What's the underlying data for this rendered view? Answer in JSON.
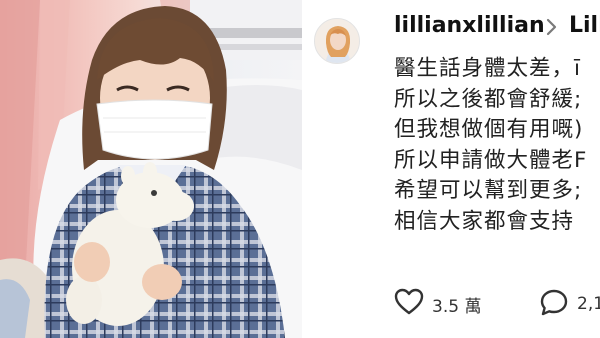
{
  "post": {
    "username": "lillianxlillian",
    "separator_icon": "chevron-right-icon",
    "reply_to_username": "Lill",
    "caption_lines": [
      "醫生話身體太差，ī",
      "所以之後都會舒緩;",
      "但我想做個有用嘅)",
      "所以申請做大體老F",
      "希望可以幫到更多;",
      "相信大家都會支持"
    ],
    "likes": "3.5 萬",
    "comments": "2,1"
  },
  "photo": {
    "subject": "woman-with-mask-holding-plush",
    "plush_icon": "moomin-plush"
  },
  "colors": {
    "text": "#222222",
    "muted": "#777777",
    "background": "#ffffff"
  }
}
